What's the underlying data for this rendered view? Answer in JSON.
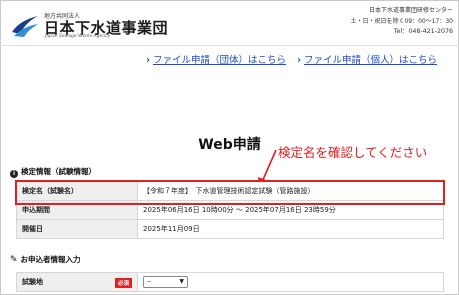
{
  "header": {
    "org_small": "地方共同法人",
    "org_name": "日本下水道事業団",
    "org_en": "Japan Sewage Works Agency",
    "center_name": "日本下水道事業団研修センター",
    "hours": "土・日・祝日を除く09：00～17：30",
    "tel": "Tel：048-421-2076"
  },
  "links": {
    "group": "ファイル申請（団体）はこちら",
    "individual": "ファイル申請（個人）はこちら"
  },
  "page": {
    "title": "Web申請"
  },
  "annotation": {
    "text": "検定名を確認してください"
  },
  "exam_section": {
    "title": "検定情報（試験情報）",
    "rows": [
      {
        "key": "検定名（試験名）",
        "value": "【令和７年度】　下水道管理技術認定試験（管路施設）"
      },
      {
        "key": "申込期間",
        "value": "2025年06月16日 10時00分 ～ 2025年07月16日 23時59分"
      },
      {
        "key": "開催日",
        "value": "2025年11月09日"
      }
    ]
  },
  "applicant_section": {
    "title": "お申込者情報入力",
    "rows": [
      {
        "key": "試験地",
        "required": "必須",
        "select_value": "--"
      }
    ]
  },
  "colors": {
    "accent_red": "#e02020",
    "link_blue": "#1a4bd6"
  },
  "icons": [
    "jswa-logo",
    "chevron-right-icon",
    "info-icon",
    "edit-icon",
    "chevron-down-icon"
  ]
}
